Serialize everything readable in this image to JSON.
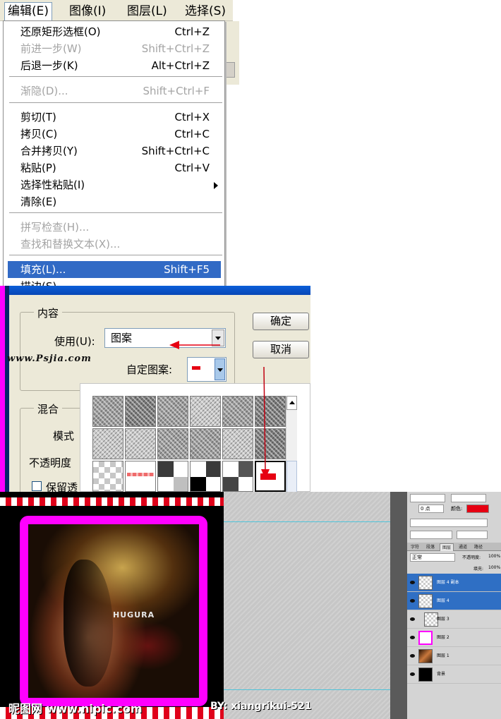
{
  "edit_menu": {
    "menubar": [
      {
        "label": "编辑(E)",
        "active": true
      },
      {
        "label": "图像(I)",
        "active": false
      },
      {
        "label": "图层(L)",
        "active": false
      },
      {
        "label": "选择(S)",
        "active": false
      }
    ],
    "items": [
      {
        "label": "还原矩形选框(O)",
        "shortcut": "Ctrl+Z",
        "disabled": false
      },
      {
        "label": "前进一步(W)",
        "shortcut": "Shift+Ctrl+Z",
        "disabled": true
      },
      {
        "label": "后退一步(K)",
        "shortcut": "Alt+Ctrl+Z",
        "disabled": false
      },
      {
        "label": "渐隐(D)...",
        "shortcut": "Shift+Ctrl+F",
        "disabled": true
      },
      {
        "label": "剪切(T)",
        "shortcut": "Ctrl+X",
        "disabled": false
      },
      {
        "label": "拷贝(C)",
        "shortcut": "Ctrl+C",
        "disabled": false
      },
      {
        "label": "合并拷贝(Y)",
        "shortcut": "Shift+Ctrl+C",
        "disabled": false
      },
      {
        "label": "粘贴(P)",
        "shortcut": "Ctrl+V",
        "disabled": false
      },
      {
        "label": "选择性粘贴(I)",
        "shortcut": "",
        "disabled": false,
        "submenu": true
      },
      {
        "label": "清除(E)",
        "shortcut": "",
        "disabled": false
      },
      {
        "label": "拼写检查(H)...",
        "shortcut": "",
        "disabled": true
      },
      {
        "label": "查找和替换文本(X)...",
        "shortcut": "",
        "disabled": true
      },
      {
        "label": "填充(L)...",
        "shortcut": "Shift+F5",
        "disabled": false,
        "highlighted": true
      },
      {
        "label": "描边(S)...",
        "shortcut": "",
        "disabled": false
      }
    ]
  },
  "fill_dialog": {
    "content_group": "内容",
    "use_label": "使用(U):",
    "use_value": "图案",
    "custom_pattern_label": "自定图案:",
    "blend_group": "混合",
    "mode_label": "模式",
    "opacity_label": "不透明度",
    "preserve_label": "保留透",
    "ok_button": "确定",
    "cancel_button": "取消",
    "watermark": "www.Psjia.com",
    "accent_color": "#e60012"
  },
  "pattern_picker": {
    "swatches": [
      "texture",
      "texture",
      "texture",
      "texture",
      "texture",
      "texture",
      "texture",
      "texture",
      "texture",
      "texture",
      "texture",
      "texture",
      "checker",
      "red-dash",
      "blocks",
      "blocks",
      "blocks",
      "red-pattern"
    ],
    "selected_index": 17
  },
  "canvas": {
    "photo_text": "HUGURA",
    "footer_watermark": "昵图网 www.nipic.com",
    "footer_credit": "BY: xiangrikui-521",
    "frame_color": "#ff00ff",
    "stripe_color": "#e0001a"
  },
  "layers_panel": {
    "char_rows": [
      "0 点",
      "颜色:"
    ],
    "text_color": "#e60012",
    "tabs": [
      "字符",
      "段落",
      "图层",
      "通道",
      "路径"
    ],
    "blend_mode": "正常",
    "opacity_label": "不透明度:",
    "opacity_value": "100%",
    "fill_label": "填充:",
    "fill_value": "100%",
    "layers": [
      {
        "name": "图层 4 副本",
        "selected": true,
        "thumb": "transparent"
      },
      {
        "name": "图层 4",
        "selected": true,
        "thumb": "transparent"
      },
      {
        "name": "图层 3",
        "selected": false,
        "thumb": "transparent"
      },
      {
        "name": "图层 2",
        "selected": false,
        "thumb": "pink"
      },
      {
        "name": "图层 1",
        "selected": false,
        "thumb": "photo"
      },
      {
        "name": "背景",
        "selected": false,
        "thumb": "black"
      }
    ]
  }
}
